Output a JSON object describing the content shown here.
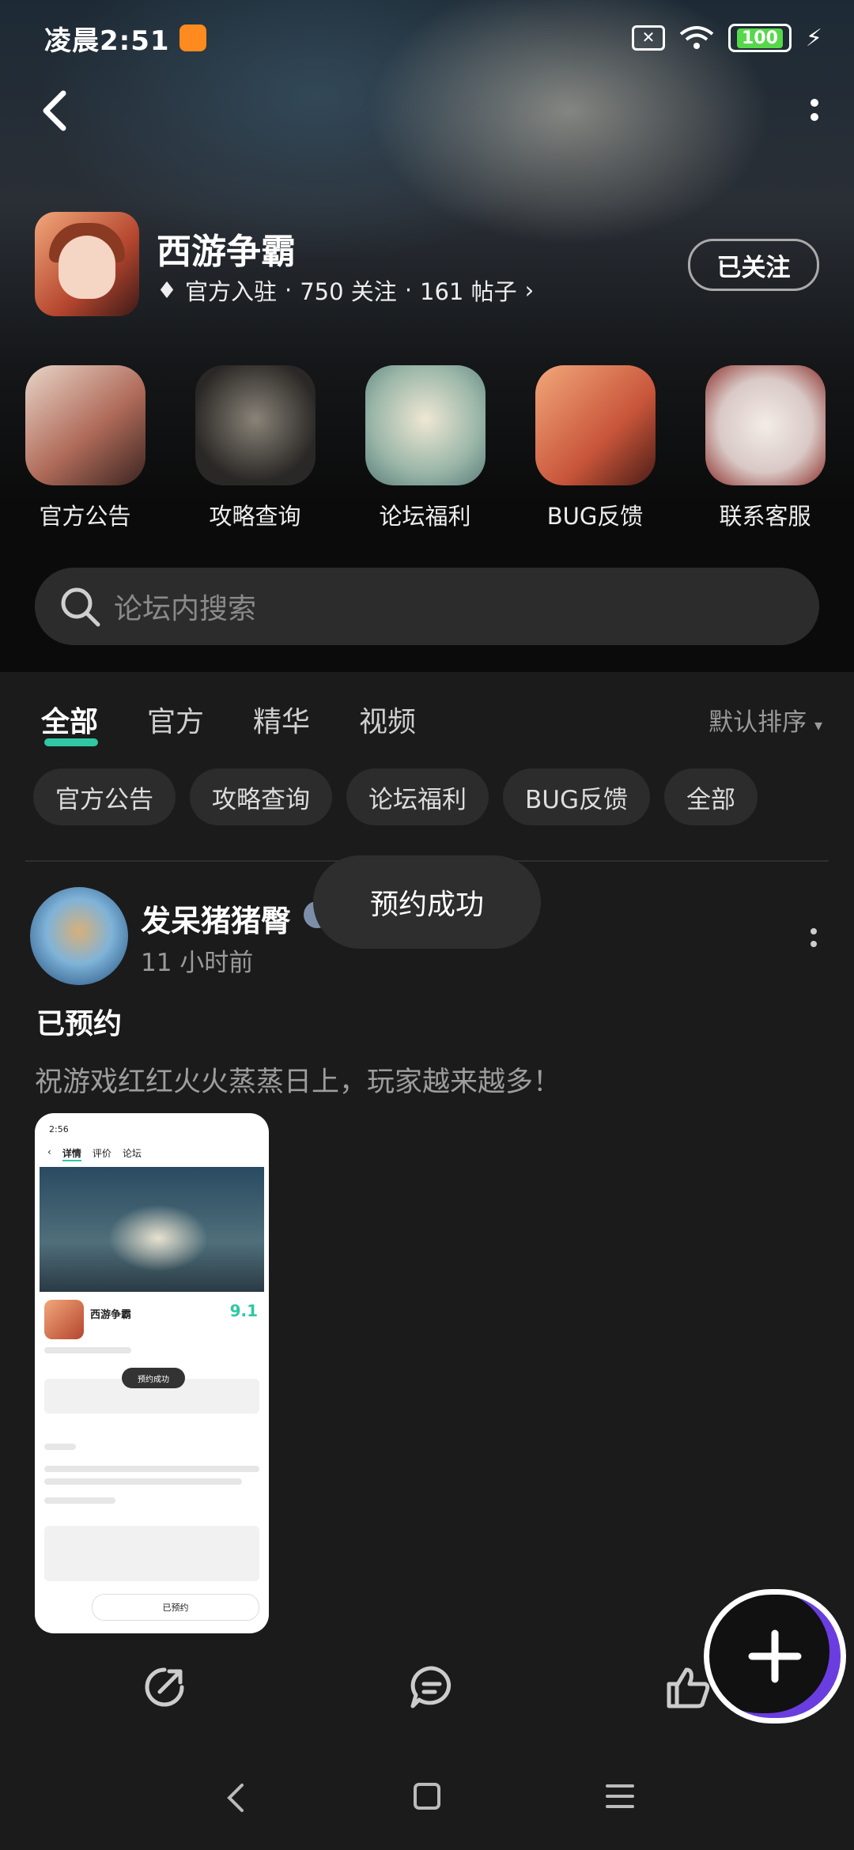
{
  "status": {
    "time": "凌晨2:51",
    "battery": "100"
  },
  "header": {
    "title": "西游争霸",
    "official": "官方入驻",
    "follows": "750 关注",
    "posts": "161 帖子",
    "follow_button": "已关注"
  },
  "quick_links": [
    {
      "label": "官方公告"
    },
    {
      "label": "攻略查询"
    },
    {
      "label": "论坛福利"
    },
    {
      "label": "BUG反馈"
    },
    {
      "label": "联系客服"
    }
  ],
  "search": {
    "placeholder": "论坛内搜索"
  },
  "tabs": [
    "全部",
    "官方",
    "精华",
    "视频"
  ],
  "sort_label": "默认排序",
  "chips": [
    "官方公告",
    "攻略查询",
    "论坛福利",
    "BUG反馈",
    "全部"
  ],
  "post": {
    "username": "发呆猪猪臀",
    "time": "11 小时前",
    "title": "已预约",
    "text": "祝游戏红红火火蒸蒸日上，玩家越来越多！",
    "screenshot": {
      "time": "2:56",
      "tabs": [
        "详情",
        "评价",
        "论坛"
      ],
      "game": "西游争霸",
      "score": "9.1",
      "toast": "预约成功",
      "button": "已预约"
    }
  },
  "toast": "预约成功"
}
